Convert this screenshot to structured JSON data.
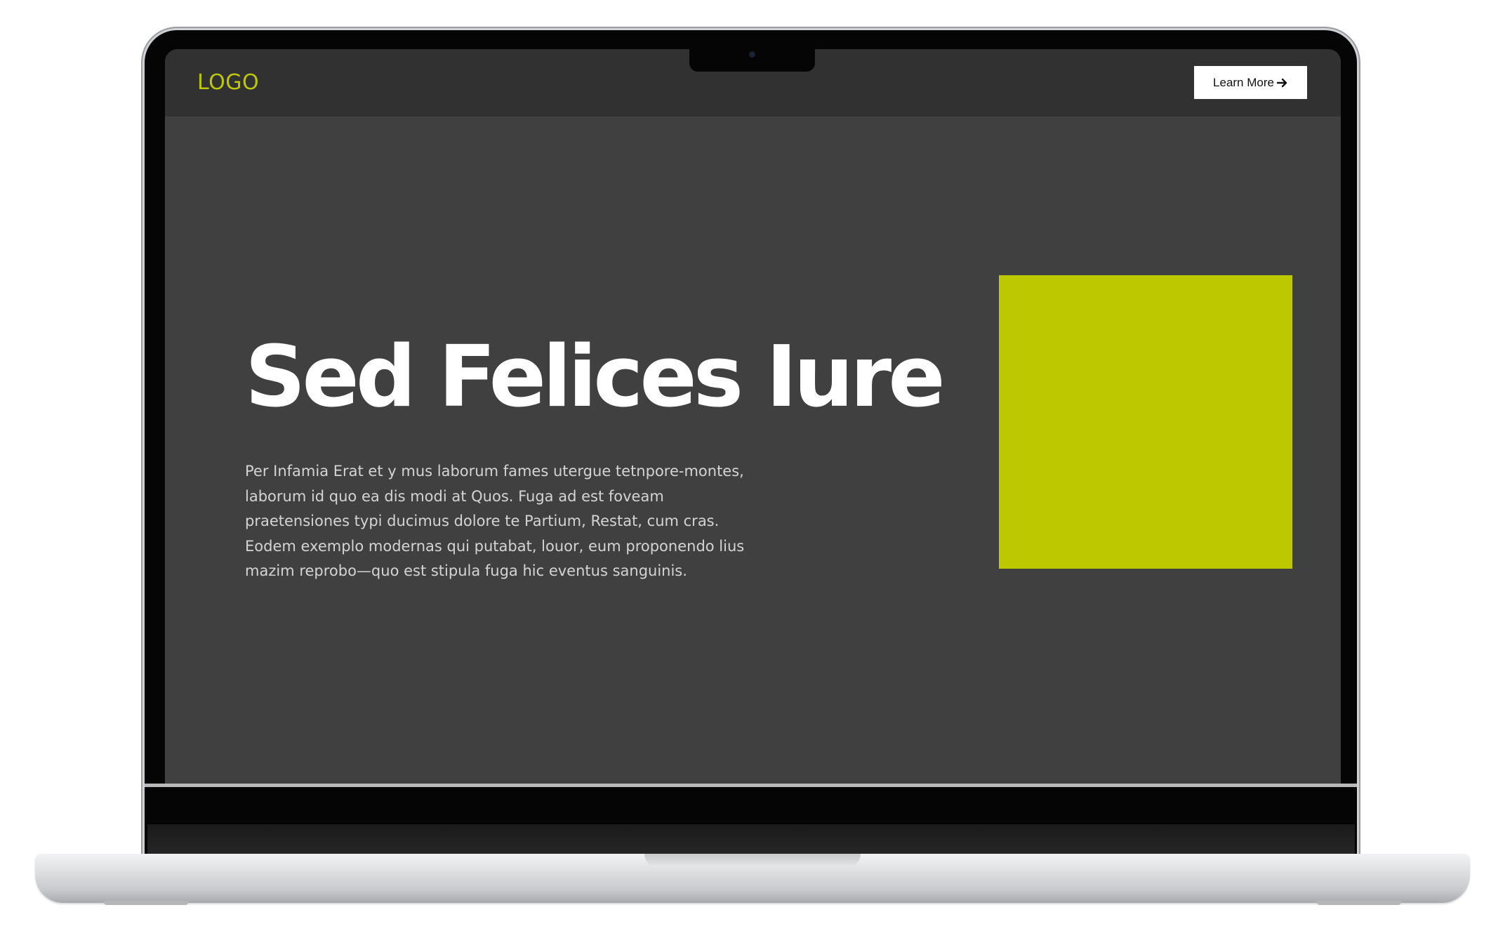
{
  "header": {
    "logo_text": "LOGO",
    "cta_label": "Learn More",
    "cta_icon": "arrow-right-icon"
  },
  "hero": {
    "title": "Sed Felices Iure",
    "body_lines": [
      "Per Infamia Erat et y mus laborum fames utergue tetnpore-montes,",
      "laborum id quo ea dis modi at Quos. Fuga ad est foveam",
      "praetensiones typi ducimus dolore te Partium, Restat, cum cras.",
      "Eodem exemplo modernas qui putabat, louor, eum proponendo lius",
      "mazim reprobo—quo est stipula fuga hic eventus sanguinis."
    ]
  },
  "colors": {
    "accent": "#bec800",
    "page_background": "#404040",
    "navbar_background": "#313131",
    "cta_background": "#ffffff"
  }
}
